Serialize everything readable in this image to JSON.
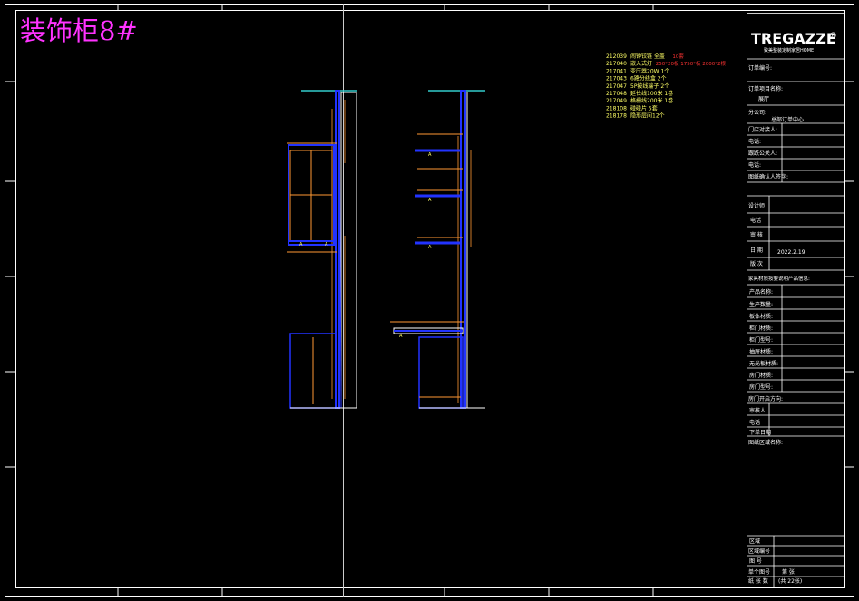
{
  "drawing_title": "装饰柜8#",
  "brand": {
    "logo": "TREGAZZE",
    "subtitle": "致美整装定制家居HOME",
    "registered": "®"
  },
  "parts_list": [
    {
      "code": "212039",
      "text": "闹钟铰链 全盖",
      "extra": "10套",
      "extra_color": "#ff3333"
    },
    {
      "code": "217040",
      "text": "嵌入式灯",
      "extra": "250*20板  1750*板 2000*2根",
      "extra_color": "#ff3333"
    },
    {
      "code": "217041",
      "text": "变压器20W  1个",
      "extra": "",
      "extra_color": ""
    },
    {
      "code": "217043",
      "text": "6路分线盒 2个",
      "extra": "",
      "extra_color": ""
    },
    {
      "code": "217047",
      "text": "5P按线端子 2个",
      "extra": "",
      "extra_color": ""
    },
    {
      "code": "217048",
      "text": "延长线100米  1卷",
      "extra": "",
      "extra_color": ""
    },
    {
      "code": "217049",
      "text": "格栅线200米  1卷",
      "extra": "",
      "extra_color": ""
    },
    {
      "code": "218108",
      "text": "碰碰片  5套",
      "extra": "",
      "extra_color": ""
    },
    {
      "code": "218178",
      "text": "隐形层间12个",
      "extra": "",
      "extra_color": ""
    }
  ],
  "title_block": {
    "order_no_label": "订单编号:",
    "project_label": "订单项目名称:",
    "project_value": "展厅",
    "company_label": "分公司:",
    "company_value": "总部订单中心",
    "store_contact_label": "门店对接人:",
    "phone_label_1": "电话:",
    "designer_label": "跟跌公关人:",
    "phone_label_2": "电话:",
    "confirm_label": "图纸确认人签字:",
    "design_label": "设计师",
    "phone_label_3": "电话",
    "review_label": "审  核",
    "date_label": "日  期",
    "date_value": "2022.2.19",
    "version_label": "版  次",
    "materials_note": "家具材质按要说明产品信息:",
    "product_name_label": "产品名称:",
    "production_qty_label": "生产数量:",
    "board_material_label": "板体材质:",
    "door_material_label": "柜门材质:",
    "door_model_label": "柜门型号:",
    "drawer_material_label": "抽屉材质:",
    "back_panel_label": "无光板材质:",
    "glass_door_label": "房门材质:",
    "glass_model_label": "房门型号:",
    "opening_label": "房门开启方向:",
    "examiner_label": "审核人",
    "phone_label_4": "电话",
    "order_date_label": "下单日期",
    "drawing_notes_label": "图纸区域名称:",
    "area_label": "区域",
    "area_no_label": "区域编号",
    "pic_no_label": "图  号",
    "total_pages_label": "单个图号",
    "page_label": "第  张",
    "sheet_label": "纸  张  数",
    "total_label": "(共 22张)"
  },
  "colors": {
    "frame": "#ffffff",
    "cabinet": "#2233ff",
    "dimension": "#ff9933",
    "cyan": "#33cccc",
    "yellow": "#ffff66",
    "title": "#ff33ff"
  }
}
